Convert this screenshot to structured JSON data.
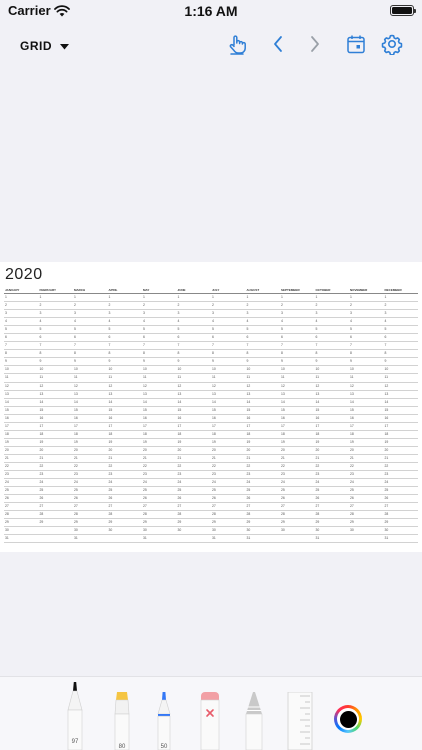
{
  "status_bar": {
    "carrier": "Carrier",
    "time": "1:16 AM"
  },
  "toolbar": {
    "mode_label": "GRID",
    "icons": [
      "touch-hand-icon",
      "chevron-left-icon",
      "chevron-right-icon",
      "calendar-icon",
      "gear-icon"
    ],
    "accent_color": "#2f7fd6"
  },
  "calendar": {
    "year": "2020",
    "months": [
      "JANUARY",
      "FEBRUARY",
      "MARCH",
      "APRIL",
      "MAY",
      "JUNE",
      "JULY",
      "AUGUST",
      "SEPTEMBER",
      "OCTOBER",
      "NOVEMBER",
      "DECEMBER"
    ],
    "month_lengths": [
      31,
      29,
      31,
      30,
      31,
      30,
      31,
      31,
      30,
      31,
      30,
      31
    ]
  },
  "tools": [
    {
      "name": "pen",
      "size_label": "97"
    },
    {
      "name": "highlighter",
      "size_label": "80"
    },
    {
      "name": "marker",
      "size_label": "50"
    },
    {
      "name": "eraser",
      "size_label": ""
    },
    {
      "name": "pencil",
      "size_label": ""
    },
    {
      "name": "ruler",
      "size_label": ""
    }
  ],
  "colors": {
    "current_ink": "#000000",
    "highlighter": "#f5c542",
    "marker": "#3478f6",
    "eraser": "#f2a0a5"
  }
}
